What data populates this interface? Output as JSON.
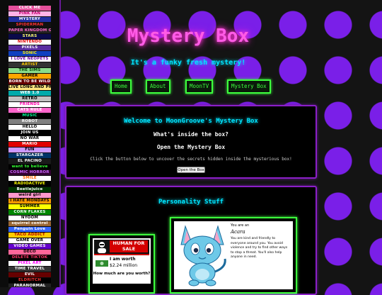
{
  "sidebar": {
    "stamps": [
      {
        "text": "CLICK ME",
        "bg": "#e44f9b",
        "fg": "#ffffff"
      },
      {
        "text": "PINK FAN",
        "bg": "#ffb3e6",
        "fg": "#c0006e"
      },
      {
        "text": "MYSTERY",
        "bg": "#2030a0",
        "fg": "#ffffff"
      },
      {
        "text": "SPIDERMAN",
        "bg": "#111111",
        "fg": "#ff3333"
      },
      {
        "text": "PAPER KINGDOM GIRL",
        "bg": "#222222",
        "fg": "#ff66cc"
      },
      {
        "text": "STARS",
        "bg": "#0a0a4a",
        "fg": "#ffff66"
      },
      {
        "text": "NINTENDO",
        "bg": "#ffffff",
        "fg": "#e00000"
      },
      {
        "text": "PIXELS",
        "bg": "#5a2da0",
        "fg": "#ffffff"
      },
      {
        "text": "SONIC",
        "bg": "#1040c0",
        "fg": "#ffee00"
      },
      {
        "text": "I LOVE NEOPETS",
        "bg": "#ffffff",
        "fg": "#6a00aa"
      },
      {
        "text": "ARTIST",
        "bg": "#333333",
        "fg": "#ffcc00"
      },
      {
        "text": "THE SIMS",
        "bg": "#8adc8a",
        "fg": "#004400"
      },
      {
        "text": "GAMER",
        "bg": "#ffa500",
        "fg": "#000000"
      },
      {
        "text": "BORN TO BE WILD",
        "bg": "#660000",
        "fg": "#ffffff"
      },
      {
        "text": "LIVE LONG AND PROSPER",
        "bg": "#ffe680",
        "fg": "#000000"
      },
      {
        "text": "WEB 1.0",
        "bg": "#00aaaa",
        "fg": "#ffffff"
      },
      {
        "text": "RETRO",
        "bg": "#c0c0c0",
        "fg": "#000000"
      },
      {
        "text": "FRIENDS",
        "bg": "#ffffff",
        "fg": "#ff00aa"
      },
      {
        "text": "CATS RULE",
        "bg": "#ff66cc",
        "fg": "#ffffff"
      },
      {
        "text": "MUSIC",
        "bg": "#000000",
        "fg": "#00ff99"
      },
      {
        "text": "ROBOT",
        "bg": "#808080",
        "fg": "#ffffff"
      },
      {
        "text": "HELLO",
        "bg": "#ffffff",
        "fg": "#000000"
      },
      {
        "text": "JOIN US",
        "bg": "#000000",
        "fg": "#ffffff"
      },
      {
        "text": "NO WAR",
        "bg": "#ffffff",
        "fg": "#000000"
      },
      {
        "text": "MARIO",
        "bg": "#e00000",
        "fg": "#ffffff"
      },
      {
        "text": "FUN",
        "bg": "#cc99ff",
        "fg": "#000000"
      },
      {
        "text": "STARGAZER",
        "bg": "#003366",
        "fg": "#ffffff"
      },
      {
        "text": "EL PACINO",
        "bg": "#1a1a1a",
        "fg": "#ffffff"
      },
      {
        "text": "want to believe",
        "bg": "#000000",
        "fg": "#33ff33"
      },
      {
        "text": "COSMIC HORROR",
        "bg": "#330033",
        "fg": "#cc66ff"
      },
      {
        "text": "SMILE",
        "bg": "#ffffff",
        "fg": "#ff6600"
      },
      {
        "text": "RADIOACTIVE",
        "bg": "#000000",
        "fg": "#ffff00"
      },
      {
        "text": "Beetlejuice",
        "bg": "#003300",
        "fg": "#ffffff"
      },
      {
        "text": "weird girl",
        "bg": "#ff99cc",
        "fg": "#000000"
      },
      {
        "text": "I HATE MONDAYS",
        "bg": "#ff9900",
        "fg": "#000000"
      },
      {
        "text": "SUMMER",
        "bg": "#ffff00",
        "fg": "#000000"
      },
      {
        "text": "CORN FLAKES",
        "bg": "#008800",
        "fg": "#ffffff"
      },
      {
        "text": "NYOOM",
        "bg": "#ffffff",
        "fg": "#000000"
      },
      {
        "text": "squirrel control",
        "bg": "#996633",
        "fg": "#ffffff"
      },
      {
        "text": "Penguin Love",
        "bg": "#3366ff",
        "fg": "#ffffff"
      },
      {
        "text": "TACO ADDICT",
        "bg": "#ffcc00",
        "fg": "#aa0000"
      },
      {
        "text": "GAME OVER",
        "bg": "#ffffff",
        "fg": "#000000"
      },
      {
        "text": "VIDEO GAMES",
        "bg": "#6600cc",
        "fg": "#ffffff"
      },
      {
        "text": "DECO",
        "bg": "#ff6699",
        "fg": "#000000"
      },
      {
        "text": "DELETE TIKTOK",
        "bg": "#000000",
        "fg": "#ff3366"
      },
      {
        "text": "PIXEL ART",
        "bg": "#ffffff",
        "fg": "#ff00ff"
      },
      {
        "text": "TIME TRAVEL",
        "bg": "#333333",
        "fg": "#ffffff"
      },
      {
        "text": "EVIL",
        "bg": "#660000",
        "fg": "#ffffff"
      },
      {
        "text": "ELDRITCH",
        "bg": "#000000",
        "fg": "#ff3333"
      },
      {
        "text": "PARANORMAL",
        "bg": "#222222",
        "fg": "#ffffff"
      }
    ]
  },
  "header": {
    "title": "Mystery Box",
    "tagline": "It's a funky fresh mystery!"
  },
  "nav": {
    "items": [
      {
        "label": "Home"
      },
      {
        "label": "About"
      },
      {
        "label": "MoonTV"
      },
      {
        "label": "Mystery Box"
      }
    ]
  },
  "intro": {
    "heading": "Welcome to MoonGroove's Mystery Box",
    "question": "What's inside the box?",
    "subheading": "Open the Mystery Box",
    "description": "Click the button below to uncover the secrets hidden inside the mysterious box!",
    "button_label": "Open the Box"
  },
  "personality": {
    "heading": "Personality Stuff",
    "badge": {
      "banner": "HUMAN FOR SALE",
      "line1": "I am worth",
      "line2": "$2.24 million",
      "line3": "How much are you worth?"
    },
    "pet": {
      "you_are": "You are an",
      "name": "Acara",
      "description": "You are kind and friendly to everyone around you. You avoid violence and try to find other ways to stop a threat. You'll also help anyone in need."
    }
  },
  "colors": {
    "background": "#141414",
    "polka_dots": "#7a1fe8",
    "title_pink": "#ff5ce6",
    "neon_cyan": "#00e5ff",
    "neon_green": "#3dff3d",
    "panel_border": "#8b1fc8"
  }
}
